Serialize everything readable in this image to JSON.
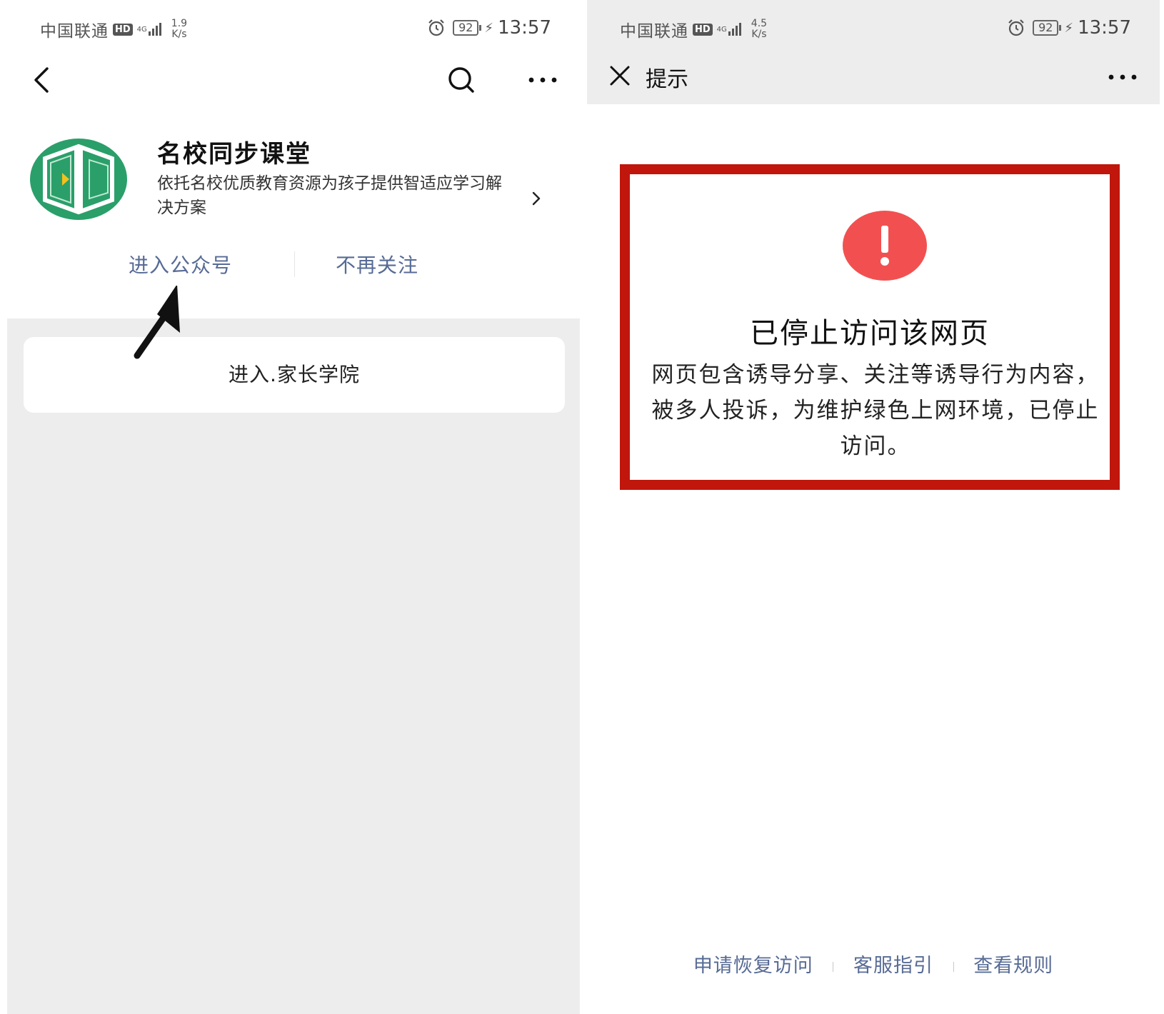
{
  "left_screen": {
    "status_bar": {
      "carrier": "中国联通",
      "hd": "HD",
      "network": "4G",
      "speed_value": "1.9",
      "speed_unit": "K/s",
      "battery": "92",
      "time": "13:57"
    },
    "account": {
      "name": "名校同步课堂",
      "description": "依托名校优质教育资源为孩子提供智适应学习解决方案"
    },
    "actions": {
      "enter_label": "进入公众号",
      "unfollow_label": "不再关注"
    },
    "menu": {
      "item_label": "进入.家长学院"
    },
    "colors": {
      "link": "#576b95",
      "logo_green": "#2a9f6a",
      "background_gray": "#ededed"
    }
  },
  "right_screen": {
    "status_bar": {
      "carrier": "中国联通",
      "hd": "HD",
      "network": "4G",
      "speed_value": "4.5",
      "speed_unit": "K/s",
      "battery": "92",
      "time": "13:57"
    },
    "nav": {
      "title": "提示"
    },
    "warning": {
      "title": "已停止访问该网页",
      "message": "网页包含诱导分享、关注等诱导行为内容，被多人投诉，为维护绿色上网环境，已停止访问。"
    },
    "footer": {
      "links": [
        "申请恢复访问",
        "客服指引",
        "查看规则"
      ]
    },
    "colors": {
      "alert_red": "#f25050",
      "highlight_border": "#c0160c",
      "link": "#576b95"
    }
  }
}
